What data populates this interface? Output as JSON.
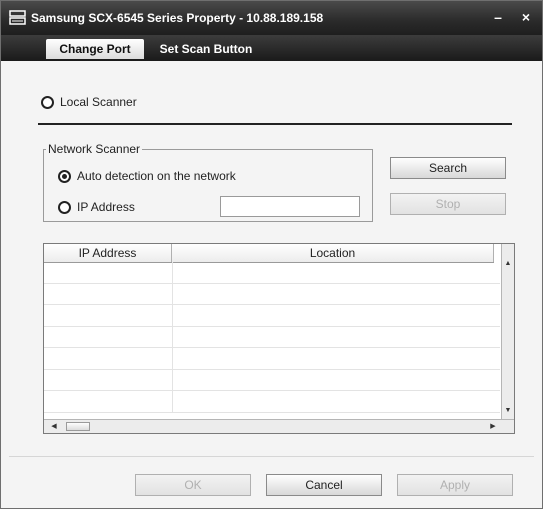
{
  "window": {
    "title": "Samsung SCX-6545 Series Property - 10.88.189.158",
    "minimize_glyph": "–",
    "close_glyph": "×"
  },
  "tabs": [
    {
      "label": "Change Port",
      "active": true
    },
    {
      "label": "Set Scan Button",
      "active": false
    }
  ],
  "local_scanner": {
    "label": "Local Scanner",
    "checked": false
  },
  "network_group": {
    "legend": "Network Scanner",
    "auto_detect": {
      "label": "Auto detection on the network",
      "checked": true
    },
    "ip_address": {
      "label": "IP Address",
      "checked": false,
      "value": ""
    }
  },
  "buttons": {
    "search": "Search",
    "stop": "Stop",
    "ok": "OK",
    "cancel": "Cancel",
    "apply": "Apply"
  },
  "table": {
    "columns": [
      "IP Address",
      "Location"
    ],
    "rows": []
  },
  "colors": {
    "titlebar": "#2a2a2a",
    "window_bg": "#f4f4f4",
    "disabled_text": "#b0b0b0"
  },
  "icons": [
    "scanner-icon",
    "minimize-icon",
    "close-icon",
    "scroll-up-icon",
    "scroll-down-icon",
    "scroll-left-icon",
    "scroll-right-icon"
  ]
}
